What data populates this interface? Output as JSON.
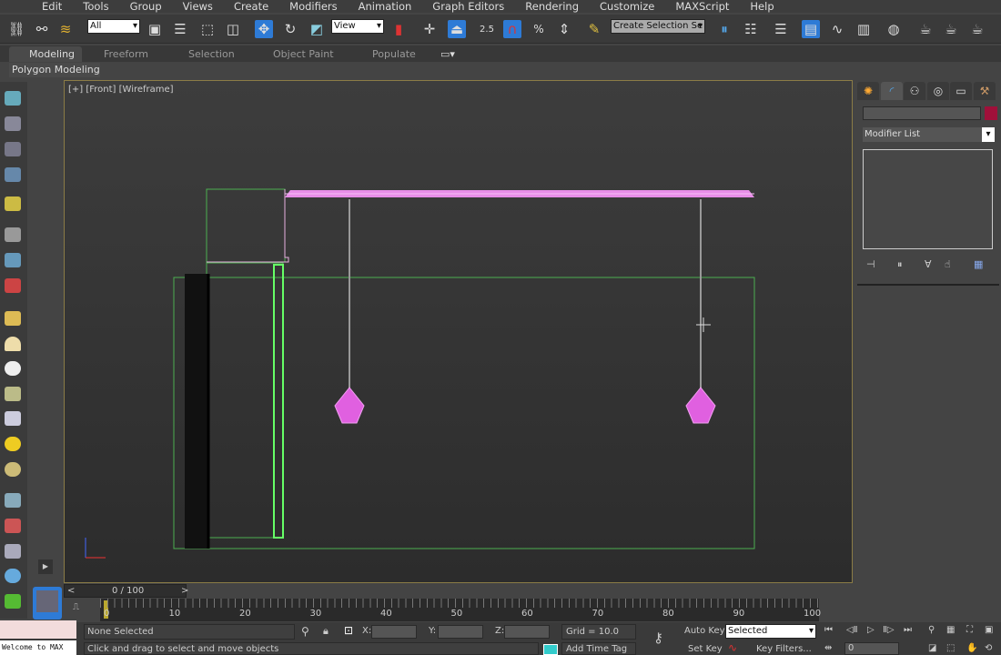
{
  "menu": [
    "Edit",
    "Tools",
    "Group",
    "Views",
    "Create",
    "Modifiers",
    "Animation",
    "Graph Editors",
    "Rendering",
    "Customize",
    "MAXScript",
    "Help"
  ],
  "toolbar": {
    "selection_filter": "All",
    "ref_coord": "View",
    "snap_value": "2.5",
    "named_selection": "Create Selection Se"
  },
  "ribbon": {
    "tabs": [
      "Modeling",
      "Freeform",
      "Selection",
      "Object Paint",
      "Populate"
    ],
    "active": "Modeling",
    "panel": "Polygon Modeling"
  },
  "viewport": {
    "label": "[+] [Front] [Wireframe]"
  },
  "command_panel": {
    "name_value": "",
    "object_color": "#a0103a",
    "modifier_list": "Modifier List"
  },
  "timeline": {
    "frame": "0 / 100",
    "ticks": [
      "0",
      "10",
      "20",
      "30",
      "40",
      "50",
      "60",
      "70",
      "80",
      "90",
      "100"
    ]
  },
  "status": {
    "selection": "None Selected",
    "prompt": "Click and drag to select and move objects",
    "x_label": "X:",
    "y_label": "Y:",
    "z_label": "Z:",
    "grid": "Grid = 10.0",
    "add_time_tag": "Add Time Tag",
    "auto_key": "Auto Key",
    "set_key": "Set Key",
    "key_mode": "Selected",
    "key_filters": "Key Filters...",
    "current_frame": "0",
    "maxscript": "Welcome to MAX"
  },
  "colors": {
    "accent": "#2e7bd6",
    "selected_wire": "#e88ee8",
    "bounds": "#4caf50",
    "viewport_border": "#8b7c46"
  }
}
